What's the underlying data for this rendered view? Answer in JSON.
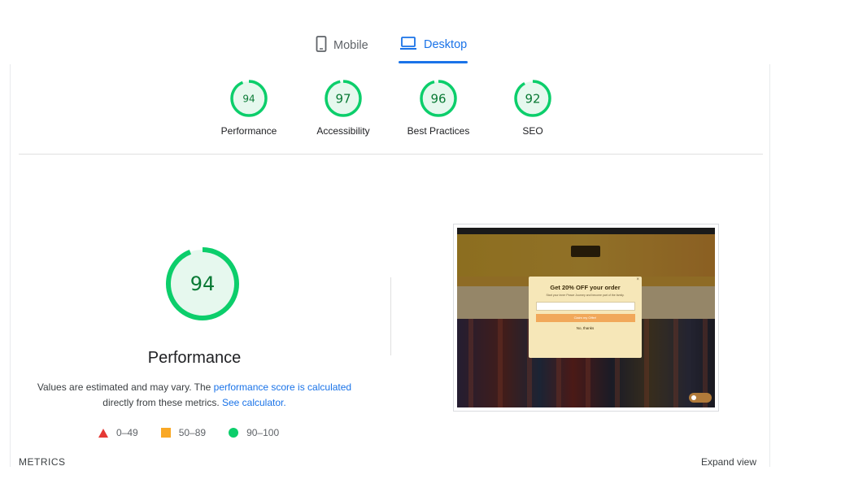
{
  "tabs": [
    {
      "label": "Mobile",
      "icon": "phone-icon",
      "active": false
    },
    {
      "label": "Desktop",
      "icon": "laptop-icon",
      "active": true
    }
  ],
  "categories": [
    {
      "score": "94",
      "score_value": 94,
      "label": "Performance"
    },
    {
      "score": "97",
      "score_value": 97,
      "label": "Accessibility"
    },
    {
      "score": "96",
      "score_value": 96,
      "label": "Best Practices"
    },
    {
      "score": "92",
      "score_value": 92,
      "label": "SEO"
    }
  ],
  "performance": {
    "score": "94",
    "score_value": 94,
    "title": "Performance",
    "desc_prefix": "Values are estimated and may vary. The ",
    "desc_link": "performance score is calculated",
    "desc_middle": "directly from these metrics. ",
    "desc_link2": "See calculator."
  },
  "legend": [
    {
      "range": "0–49",
      "shape": "triangle",
      "color": "#e53935"
    },
    {
      "range": "50–89",
      "shape": "square",
      "color": "#f9a825"
    },
    {
      "range": "90–100",
      "shape": "circle",
      "color": "#0cce6b"
    }
  ],
  "metrics_label": "METRICS",
  "expand_view_label": "Expand view",
  "colors": {
    "accent": "#1a73e8",
    "good": "#0cce6b",
    "good_text": "#0a7a35",
    "good_bg": "#e6f8ee"
  },
  "screenshot": {
    "popup_title": "Get 20% OFF your order",
    "popup_subtitle": "Start your inner Peace Journey and become part of the family.",
    "popup_button": "Claim my Offer!",
    "popup_decline": "No, thanks"
  }
}
